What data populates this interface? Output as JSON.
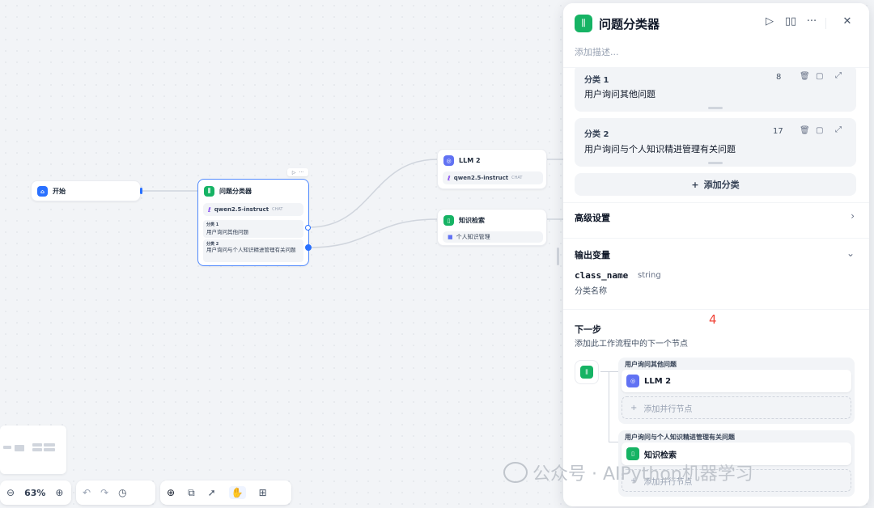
{
  "canvas": {
    "start_node": {
      "label": "开始"
    },
    "classifier_node": {
      "title": "问题分类器",
      "model": "qwen2.5-instruct",
      "model_tag": "CHAT",
      "classes": [
        {
          "label": "分类 1",
          "text": "用户询问其他问题"
        },
        {
          "label": "分类 2",
          "text": "用户询问与个人知识精进管理有关问题"
        }
      ]
    },
    "llm_node": {
      "title": "LLM 2",
      "model": "qwen2.5-instruct",
      "model_tag": "CHAT"
    },
    "knowledge_node": {
      "title": "知识检索",
      "dataset": "个人知识管理"
    }
  },
  "panel": {
    "title": "问题分类器",
    "description_placeholder": "添加描述...",
    "classes": [
      {
        "label": "分类 1",
        "count": "8",
        "text": "用户询问其他问题"
      },
      {
        "label": "分类 2",
        "count": "17",
        "text": "用户询问与个人知识精进管理有关问题"
      }
    ],
    "add_class_label": "添加分类",
    "advanced_settings": "高级设置",
    "output_vars_title": "输出变量",
    "output_var": {
      "name": "class_name",
      "type": "string",
      "desc": "分类名称"
    },
    "next_step": {
      "title": "下一步",
      "desc": "添加此工作流程中的下一个节点",
      "branches": [
        {
          "label": "用户询问其他问题",
          "target": "LLM 2",
          "add_parallel": "添加并行节点"
        },
        {
          "label": "用户询问与个人知识精进管理有关问题",
          "target": "知识检索",
          "add_parallel": "添加并行节点"
        }
      ]
    }
  },
  "toolbar": {
    "zoom": "63%"
  },
  "annotation": {
    "number": "4"
  },
  "watermark": {
    "text": "公众号 · AIPython机器学习"
  },
  "colors": {
    "accent": "#2970ff",
    "green": "#16b364",
    "indigo": "#6172f3",
    "annotation": "#f04438"
  }
}
